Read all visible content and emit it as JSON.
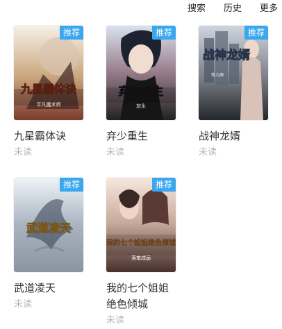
{
  "header": {
    "search": "搜索",
    "history": "历史",
    "more": "更多"
  },
  "books": [
    {
      "title": "九星霸体诀",
      "status": "未读",
      "badge": "推荐",
      "cover": {
        "title_text": "九星霸体诀",
        "author_text": "平凡魔术师"
      }
    },
    {
      "title": "弃少重生",
      "status": "未读",
      "badge": "推荐",
      "cover": {
        "title_text": "弃少重生",
        "author_text": "旅永"
      }
    },
    {
      "title": "战神龙婿",
      "status": "未读",
      "badge": "推荐",
      "cover": {
        "title_text": "战神龙婿",
        "author_text": "牧九卿"
      }
    },
    {
      "title": "武道凌天",
      "status": "未读",
      "badge": "推荐",
      "cover": {
        "title_text": "武道凌天",
        "author_text": ""
      }
    },
    {
      "title": "我的七个姐姐绝色倾城",
      "status": "未读",
      "badge": "推荐",
      "cover": {
        "title_text": "我的七个姐姐绝色倾城",
        "author_text": "落笔成画"
      }
    }
  ]
}
